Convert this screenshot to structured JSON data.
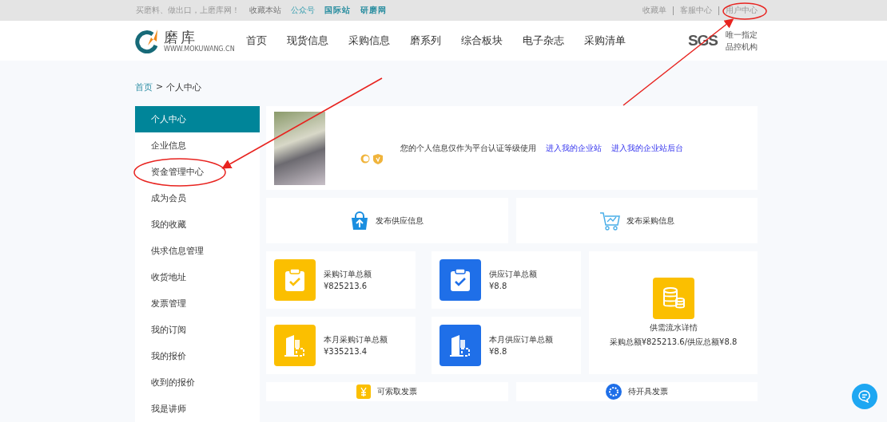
{
  "top_bar": {
    "slogan": "买磨料、做出口，上磨库网！",
    "links": [
      {
        "label": "收藏本站",
        "kind": "plain"
      },
      {
        "label": "公众号",
        "kind": "teal"
      },
      {
        "label": "国际站",
        "kind": "bold"
      },
      {
        "label": "研磨网",
        "kind": "bold"
      }
    ],
    "right_links": [
      "收藏单",
      "客服中心",
      "用户中心"
    ]
  },
  "logo": {
    "name": "磨库",
    "tagline": "WWW.MOKUWANG.CN"
  },
  "nav": [
    "首页",
    "现货信息",
    "采购信息",
    "磨系列",
    "综合板块",
    "电子杂志",
    "采购清单"
  ],
  "sgs": {
    "mark": "SGS",
    "lines": [
      "唯一指定",
      "品控机构"
    ]
  },
  "breadcrumb": {
    "home": "首页",
    "separator": ">",
    "current": "个人中心"
  },
  "sidebar": [
    {
      "label": "个人中心",
      "selected": true
    },
    {
      "label": "企业信息",
      "selected": false
    },
    {
      "label": "资金管理中心",
      "selected": false
    },
    {
      "label": "成为会员",
      "selected": false
    },
    {
      "label": "我的收藏",
      "selected": false
    },
    {
      "label": "供求信息管理",
      "selected": false
    },
    {
      "label": "收货地址",
      "selected": false
    },
    {
      "label": "发票管理",
      "selected": false
    },
    {
      "label": "我的订阅",
      "selected": false
    },
    {
      "label": "我的报价",
      "selected": false
    },
    {
      "label": "收到的报价",
      "selected": false
    },
    {
      "label": "我是讲师",
      "selected": false
    }
  ],
  "profile": {
    "notice": "您的个人信息仅作为平台认证等级使用",
    "links": [
      "进入我的企业站",
      "进入我的企业站后台"
    ]
  },
  "publish": [
    {
      "label": "发布供应信息",
      "kind": "bag"
    },
    {
      "label": "发布采购信息",
      "kind": "cart"
    }
  ],
  "stats": [
    {
      "title": "采购订单总额",
      "value": "¥825213.6",
      "kind": "clipboard",
      "color": "#fbbf00"
    },
    {
      "title": "供应订单总额",
      "value": "¥8.8",
      "kind": "clipboard",
      "color": "#1f6fe8"
    },
    {
      "title": "本月采购订单总额",
      "value": "¥335213.4",
      "kind": "building",
      "color": "#fbbf00"
    },
    {
      "title": "本月供应订单总额",
      "value": "¥8.8",
      "kind": "building",
      "color": "#1f6fe8"
    }
  ],
  "summary": {
    "title": "供需流水详情",
    "text": "采购总额¥825213.6/供应总额¥8.8"
  },
  "invoices": [
    {
      "label": "可索取发票",
      "kind": "yen"
    },
    {
      "label": "待开具发票",
      "kind": "dial"
    }
  ]
}
